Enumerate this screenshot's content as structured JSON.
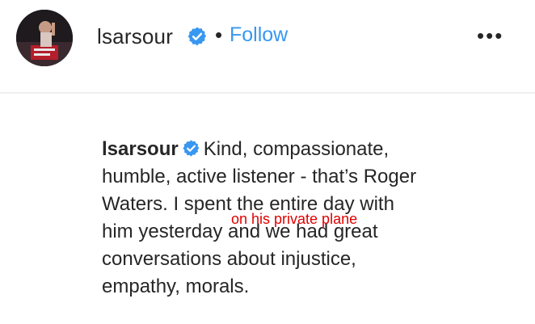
{
  "header": {
    "username": "lsarsour",
    "separator": "•",
    "follow_label": "Follow",
    "more_label": "•••",
    "icons": {
      "avatar": "profile-photo",
      "verified": "verified-badge-icon",
      "more": "more-options-icon"
    }
  },
  "caption": {
    "username": "lsarsour",
    "lines": [
      "Kind, compassionate,",
      "humble, active listener - that’s Roger",
      "Waters. I spent the entire day with",
      "him yesterday and we had great",
      "conversations about injustice,",
      "empathy, morals."
    ]
  },
  "overlay_annotation": "on his private plane",
  "colors": {
    "link": "#3897f0",
    "text": "#262626",
    "verified": "#3897f0",
    "annotation": "#e00000"
  }
}
